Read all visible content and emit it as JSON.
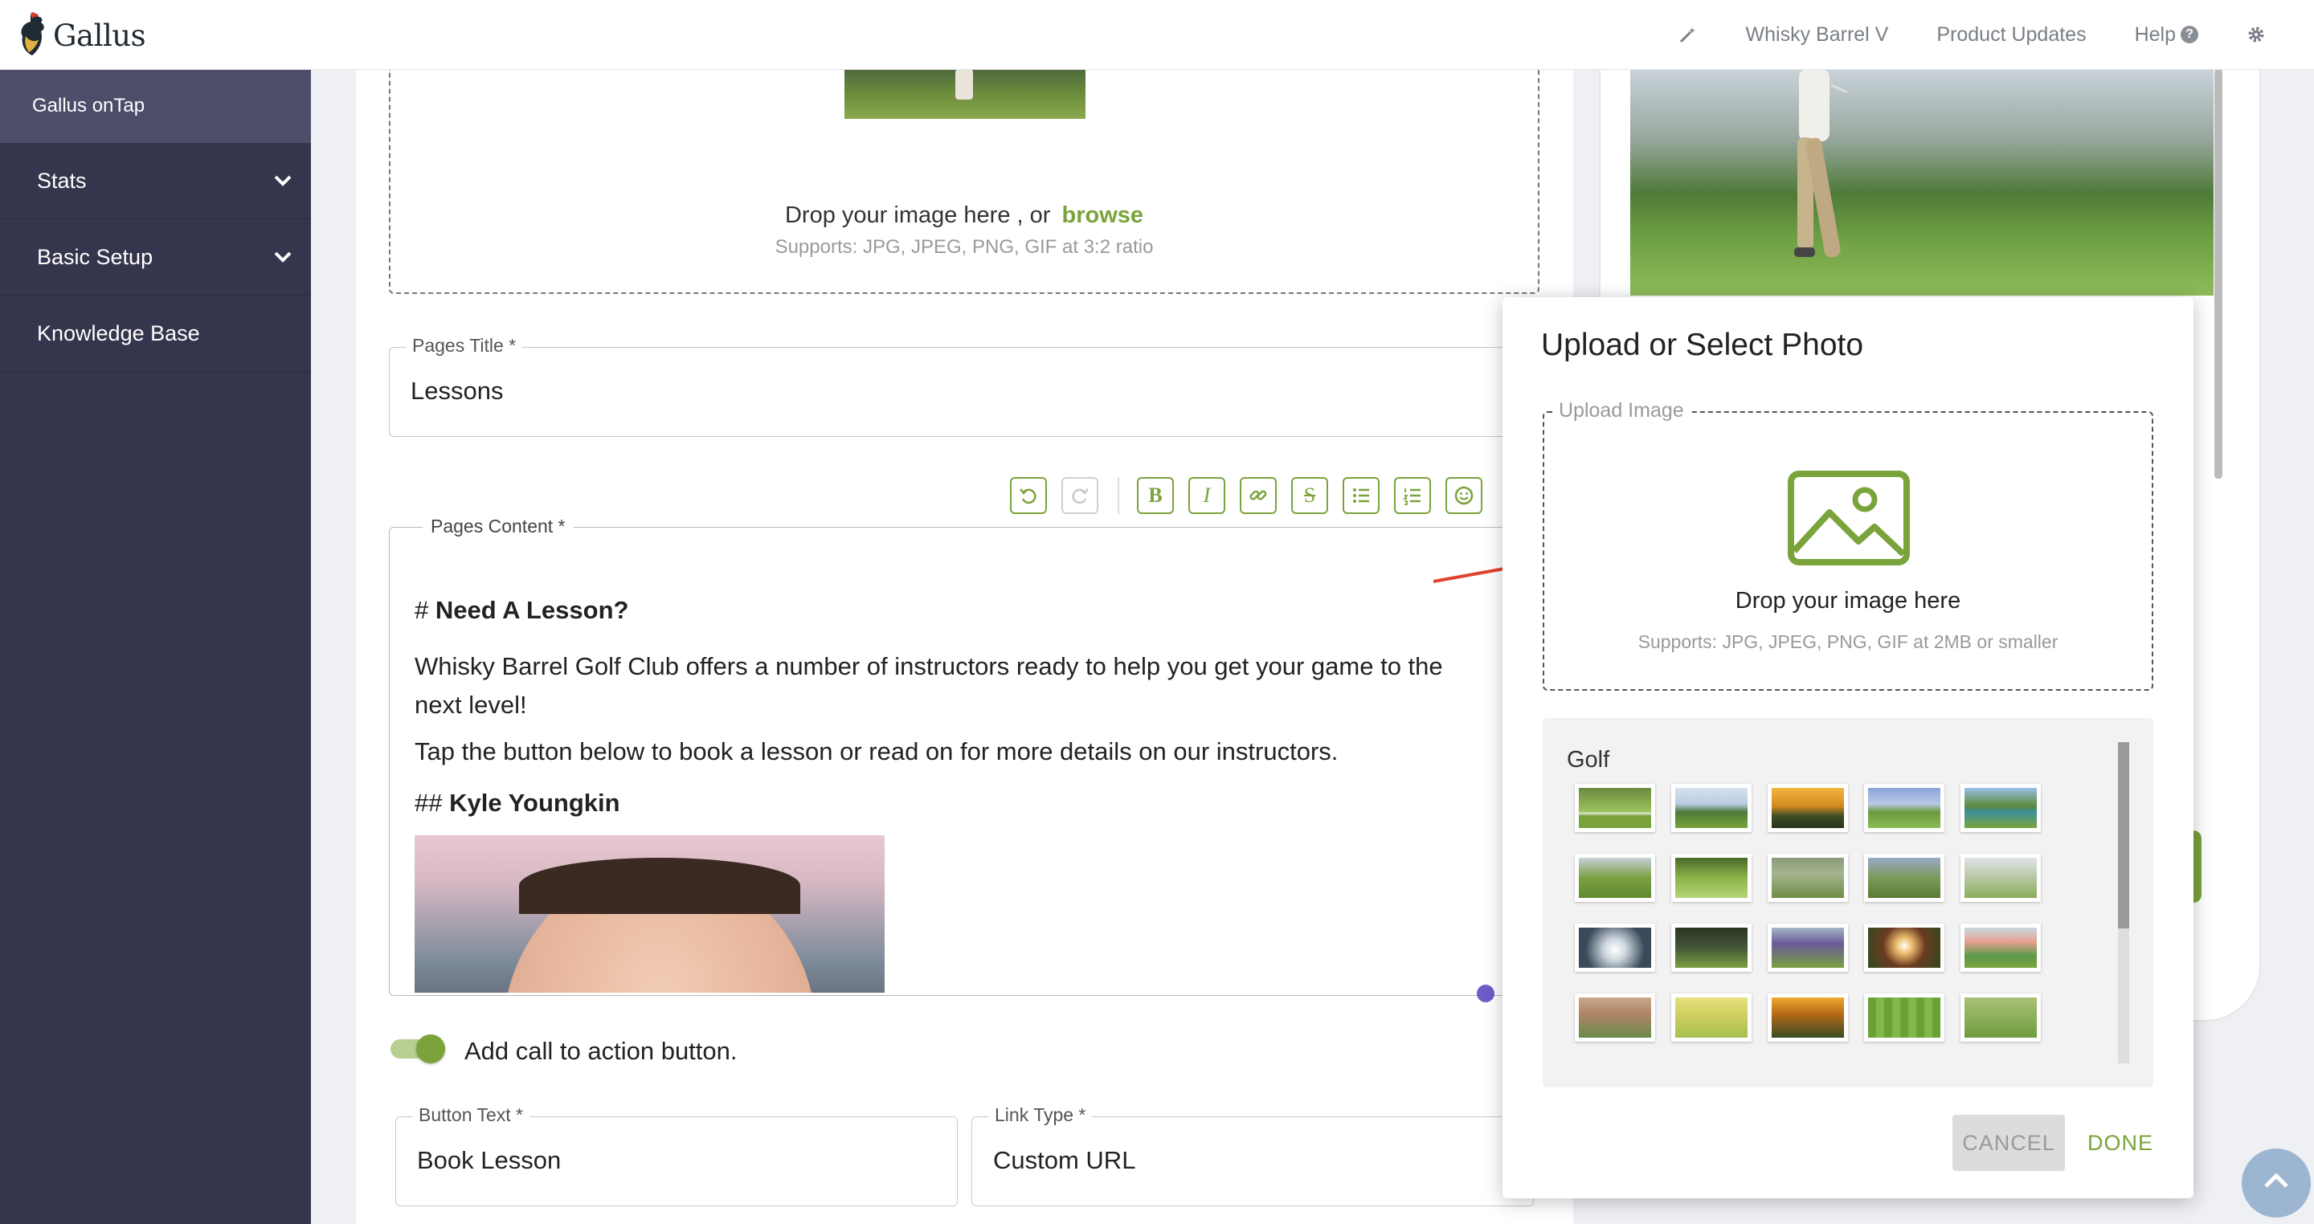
{
  "header": {
    "logo_text": "Gallus",
    "nav": [
      "Whisky Barrel V",
      "Product Updates",
      "Help"
    ],
    "icons": [
      "wand-icon",
      "help-icon",
      "gear-icon"
    ]
  },
  "sidebar": {
    "header": "Gallus onTap",
    "items": [
      {
        "label": "Stats"
      },
      {
        "label": "Basic Setup"
      },
      {
        "label": "Knowledge Base"
      }
    ]
  },
  "image_dropzone": {
    "text": "Drop your image here , or",
    "browse": "browse",
    "supports": "Supports: JPG, JPEG, PNG, GIF at 3:2 ratio"
  },
  "pages_title": {
    "label": "Pages Title *",
    "value": "Lessons"
  },
  "pages_content": {
    "label": "Pages Content *",
    "h1_prefix": "#",
    "h1": "Need A Lesson?",
    "p1_line1": "Whisky Barrel Golf Club offers a number of instructors ready to help you get your game to the",
    "p1_line2": "next level!",
    "p2": "Tap the button below to book a lesson or read on for more details on our instructors.",
    "h2_prefix": "##",
    "h2": "Kyle Youngkin"
  },
  "cta_toggle": {
    "label": "Add call to action button.",
    "enabled": true
  },
  "button_text": {
    "label": "Button Text *",
    "value": "Book Lesson"
  },
  "link_type": {
    "label": "Link Type *",
    "value": "Custom URL"
  },
  "modal": {
    "title": "Upload or Select Photo",
    "upload_label": "Upload Image",
    "drop_text": "Drop your image here",
    "supports": "Supports: JPG, JPEG, PNG, GIF at 2MB or smaller",
    "gallery_title": "Golf",
    "cancel": "CANCEL",
    "done": "DONE"
  },
  "colors": {
    "accent": "#7aa33b",
    "sidebar": "#35354d",
    "sidebar_header": "#4d4e6a",
    "arrow": "#e0432f"
  }
}
